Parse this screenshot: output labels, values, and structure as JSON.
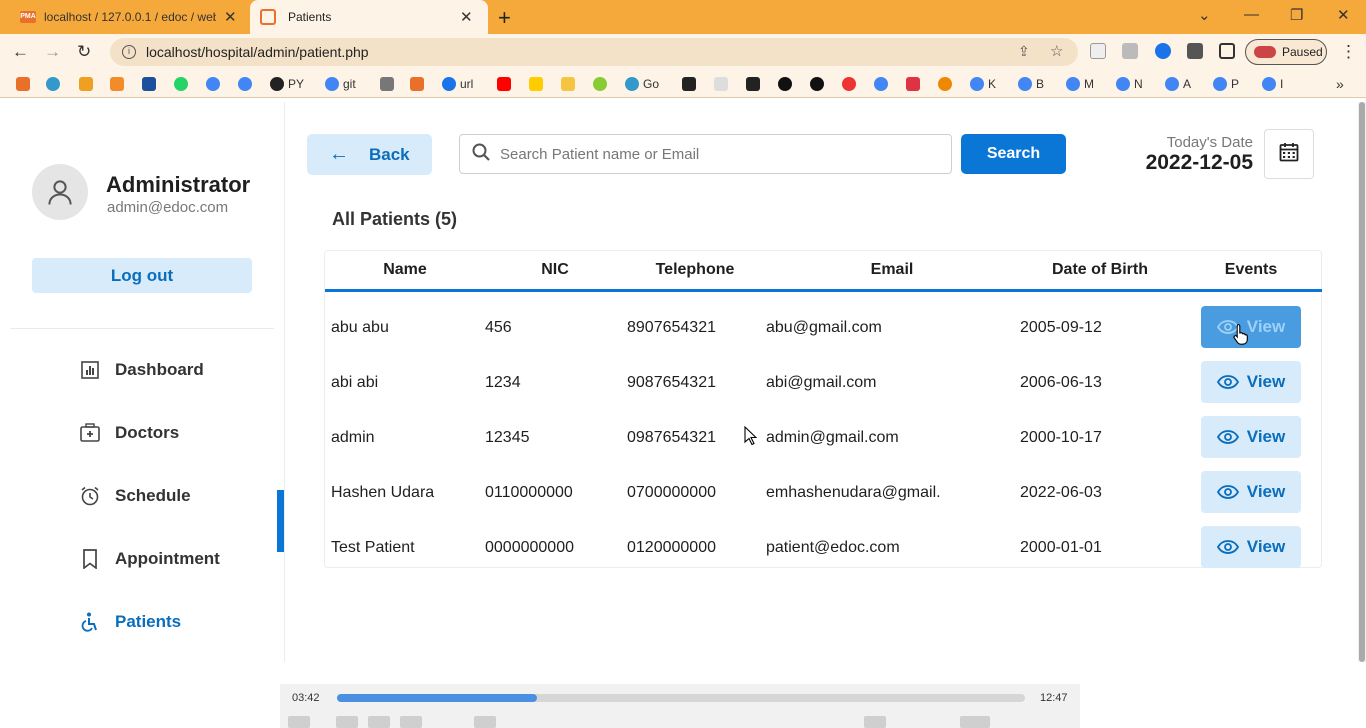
{
  "browser": {
    "tabs": [
      {
        "title": "localhost / 127.0.0.1 / edoc / web",
        "active": false
      },
      {
        "title": "Patients",
        "active": true
      }
    ],
    "url": "localhost/hospital/admin/patient.php",
    "profile_status": "Paused",
    "bookmarks": [
      "PY",
      "git",
      "url",
      "Go",
      "K",
      "B",
      "M",
      "N",
      "A",
      "P",
      "I"
    ]
  },
  "sidebar": {
    "admin_name": "Administrator",
    "admin_email": "admin@edoc.com",
    "logout_label": "Log out",
    "menu": [
      {
        "label": "Dashboard",
        "icon": "dashboard-icon",
        "active": false
      },
      {
        "label": "Doctors",
        "icon": "doctors-icon",
        "active": false
      },
      {
        "label": "Schedule",
        "icon": "schedule-icon",
        "active": false
      },
      {
        "label": "Appointment",
        "icon": "appointment-icon",
        "active": false
      },
      {
        "label": "Patients",
        "icon": "patients-icon",
        "active": true
      }
    ]
  },
  "toolbar": {
    "back_label": "Back",
    "search_placeholder": "Search Patient name or Email",
    "search_label": "Search",
    "today_label": "Today's Date",
    "today_value": "2022-12-05"
  },
  "patients": {
    "heading": "All Patients (5)",
    "columns": [
      "Name",
      "NIC",
      "Telephone",
      "Email",
      "Date of Birth",
      "Events"
    ],
    "view_label": "View",
    "rows": [
      {
        "name": "abu abu",
        "nic": "456",
        "tel": "8907654321",
        "email": "abu@gmail.com",
        "dob": "2005-09-12"
      },
      {
        "name": "abi abi",
        "nic": "1234",
        "tel": "9087654321",
        "email": "abi@gmail.com",
        "dob": "2006-06-13"
      },
      {
        "name": "admin",
        "nic": "12345",
        "tel": "0987654321",
        "email": "admin@gmail.com",
        "dob": "2000-10-17"
      },
      {
        "name": "Hashen Udara",
        "nic": "0110000000",
        "tel": "0700000000",
        "email": "emhashenudara@gmail.",
        "dob": "2022-06-03"
      },
      {
        "name": "Test Patient",
        "nic": "0000000000",
        "tel": "0120000000",
        "email": "patient@edoc.com",
        "dob": "2000-01-01"
      }
    ]
  },
  "player": {
    "current_time": "03:42",
    "total_time": "12:47",
    "progress": 0.29
  },
  "colors": {
    "accent": "#0a76d6",
    "accent_light": "#d8ebfa",
    "browser_frame": "#f6a93b"
  }
}
